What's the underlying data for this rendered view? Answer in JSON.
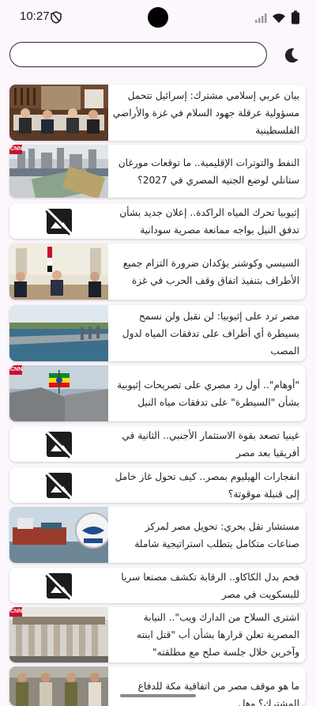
{
  "status_bar": {
    "time": "10:27"
  },
  "search": {
    "value": "",
    "placeholder": ""
  },
  "icons": {
    "theme_toggle": "moon-icon",
    "no_image": "image-not-supported-icon"
  },
  "news": [
    {
      "title": "بيان عربي إسلامي مشترك: إسرائيل تتحمل مسؤولية عرقلة جهود السلام في غزة والأراضي الفلسطينية",
      "image": "meeting-photo",
      "badge": ""
    },
    {
      "title": "النفط والتوترات الإقليمية.. ما توقعات مورغان ستانلي لوضع الجنيه المصري في 2027؟",
      "image": "cairo-skyline-money-photo",
      "badge": "CNN"
    },
    {
      "title": "إثيوبيا تحرك المياه الراكدة.. إعلان جديد بشأن تدفق النيل يواجه ممانعة مصرية سودانية",
      "image": "none",
      "badge": ""
    },
    {
      "title": "السيسي وكوشنر يؤكدان ضرورة التزام جميع الأطراف بتنفيذ اتفاق وقف الحرب في غزة",
      "image": "palace-meeting-photo",
      "badge": ""
    },
    {
      "title": "مصر ترد على إثيوبيا: لن نقبل ولن نسمح بسيطرة أي أطراف على تدفقات المياه لدول المصب",
      "image": "dam-river-photo",
      "badge": ""
    },
    {
      "title": "\"أوهام\".. أول رد مصري على تصريحات إثيوبية بشأن \"السيطرة\" على تدفقات مياه النيل",
      "image": "dam-flag-photo",
      "badge": "CNN"
    },
    {
      "title": "غينيا تصعد بقوة الاستثمار الأجنبي.. الثانية في أفريقيا بعد مصر",
      "image": "none",
      "badge": ""
    },
    {
      "title": "انفجارات الهيليوم بمصر.. كيف تحول غاز خامل إلى قنبلة موقوتة؟",
      "image": "none",
      "badge": ""
    },
    {
      "title": "مستشار نقل بحري: تحويل مصر لمركز صناعات متكامل يتطلب استراتيجية شاملة",
      "image": "ship-canal-photo",
      "badge": ""
    },
    {
      "title": "فحم بدل الكاكاو.. الرقابة تكشف مصنعا سريا للبسكويت في مصر",
      "image": "none",
      "badge": ""
    },
    {
      "title": "اشترى السلاح من الدارك ويب\".. النيابة المصرية تعلن قرارها بشأن أب \"قتل ابنته وآخرين خلال جلسة صلح مع مطلقته\"",
      "image": "court-building-photo",
      "badge": "CNN"
    },
    {
      "title": "ما هو موقف مصر من اتفاقية مكة للدفاع المشترك؟ وهل",
      "image": "military-officers-photo",
      "badge": ""
    }
  ]
}
